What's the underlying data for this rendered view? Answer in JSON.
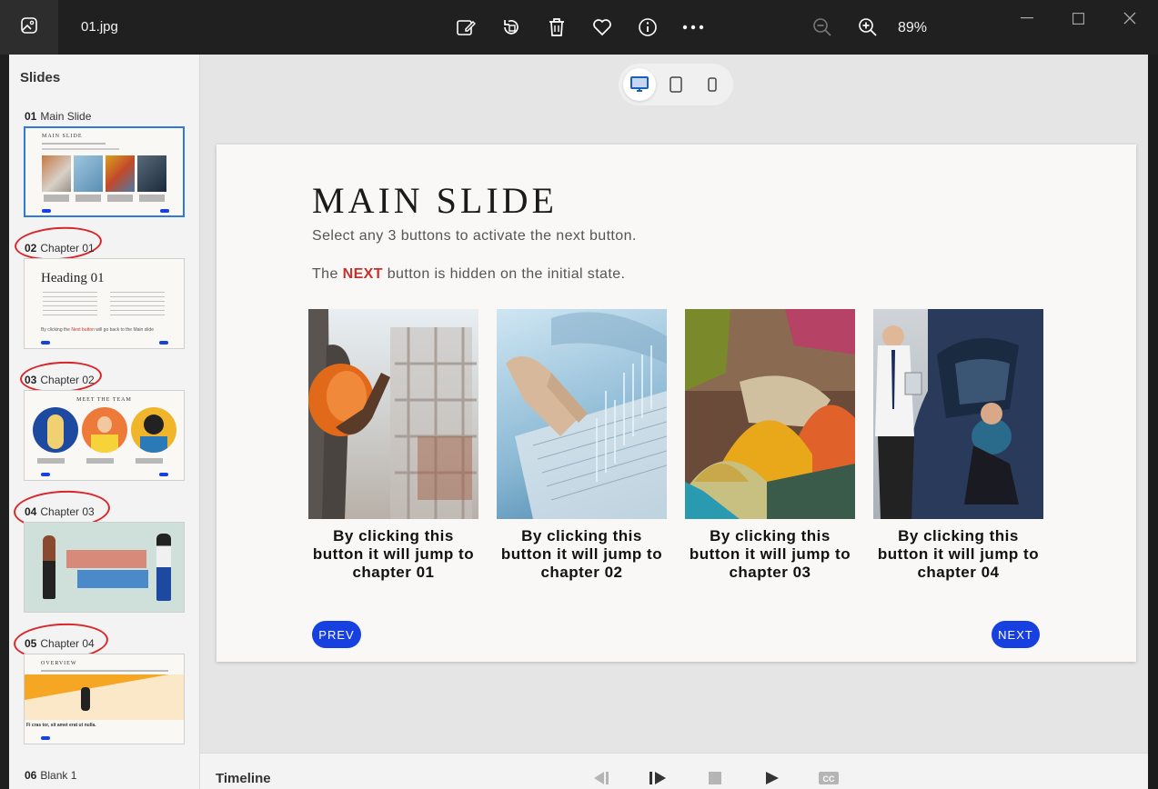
{
  "window": {
    "file_name": "01.jpg",
    "zoom": "89%"
  },
  "sidebar": {
    "title": "Slides",
    "items": [
      {
        "num": "01",
        "label": "Main Slide"
      },
      {
        "num": "02",
        "label": "Chapter 01"
      },
      {
        "num": "03",
        "label": "Chapter 02"
      },
      {
        "num": "04",
        "label": "Chapter 03"
      },
      {
        "num": "05",
        "label": "Chapter 04"
      },
      {
        "num": "06",
        "label": "Blank 1"
      }
    ],
    "thumb1": {
      "title": "MAIN SLIDE"
    },
    "thumb2": {
      "title": "Heading 01",
      "footer_a": "By clicking the ",
      "footer_b": "Next button",
      "footer_c": " will go back to the Main slide"
    },
    "thumb3": {
      "title": "MEET THE TEAM"
    },
    "thumb5": {
      "title": "OVERVIEW",
      "body": "Fi cras tor, sit amet erat ut nulla."
    }
  },
  "slide": {
    "title": "MAIN SLIDE",
    "subtitle": "Select any 3 buttons to activate the next button.",
    "line2_a": "The ",
    "line2_hl": "NEXT",
    "line2_b": " button is hidden on the initial state.",
    "cards": [
      {
        "caption": "By clicking this button it will jump to chapter 01"
      },
      {
        "caption": "By clicking this button it will jump to chapter 02"
      },
      {
        "caption": "By clicking this button it will jump to chapter 03"
      },
      {
        "caption": "By clicking this button it will jump to chapter 04"
      }
    ],
    "prev_label": "PREV",
    "next_label": "NEXT"
  },
  "timeline": {
    "label": "Timeline"
  },
  "colors": {
    "accent": "#1640e0",
    "highlight": "#c9302c",
    "annotation": "#d8262b",
    "selection": "#2f7ad8"
  },
  "icons": [
    "image-icon",
    "edit-image-icon",
    "rotate-icon",
    "delete-icon",
    "favorite-icon",
    "info-icon",
    "more-icon",
    "zoom-out-icon",
    "zoom-in-icon",
    "minimize-icon",
    "maximize-icon",
    "close-icon",
    "desktop-icon",
    "tablet-icon",
    "phone-icon",
    "rewind-icon",
    "step-forward-icon",
    "stop-icon",
    "play-icon",
    "closed-captions-icon"
  ]
}
